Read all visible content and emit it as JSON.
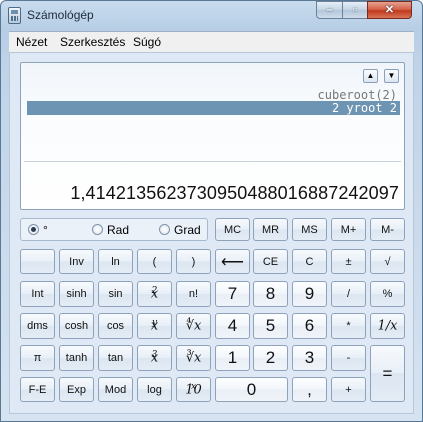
{
  "window": {
    "title": "Számológép"
  },
  "caption_buttons": {
    "minimize": "–",
    "maximize": "▫",
    "close": "✕"
  },
  "menu": [
    "Nézet",
    "Szerkesztés",
    "Súgó"
  ],
  "display": {
    "history": [
      "cuberoot(2)",
      "2 yroot 2"
    ],
    "result": "1,4142135623730950488016887242097",
    "scroll_up": "▲",
    "scroll_down": "▼"
  },
  "angle_units": {
    "options": [
      "°",
      "Rad",
      "Grad"
    ],
    "selected": "°"
  },
  "keys": {
    "mc": "MC",
    "mr": "MR",
    "ms": "MS",
    "mplus": "M+",
    "mminus": "M-",
    "inv": "Inv",
    "ln": "ln",
    "lparen": "(",
    "rparen": ")",
    "backspace": "⟵",
    "ce": "CE",
    "c": "C",
    "plusminus": "±",
    "sqrt": "√",
    "int": "Int",
    "sinh": "sinh",
    "sin": "sin",
    "x2_base": "x",
    "x2_exp": "2",
    "fact": "n!",
    "d7": "7",
    "d8": "8",
    "d9": "9",
    "div": "/",
    "pct": "%",
    "dms": "dms",
    "cosh": "cosh",
    "cos": "cos",
    "xy_base": "x",
    "xy_exp": "y",
    "yroot": "∜x",
    "d4": "4",
    "d5": "5",
    "d6": "6",
    "mul": "*",
    "recip": "1/x",
    "pi": "π",
    "tanh": "tanh",
    "tan": "tan",
    "x3_base": "x",
    "x3_exp": "3",
    "cuberoot": "∛x",
    "d1": "1",
    "d2": "2",
    "d3": "3",
    "sub": "-",
    "equals": "=",
    "fe": "F-E",
    "exp": "Exp",
    "mod": "Mod",
    "log": "log",
    "tenx_base": "10",
    "tenx_exp": "x",
    "d0": "0",
    "dot": ",",
    "add": "+"
  }
}
